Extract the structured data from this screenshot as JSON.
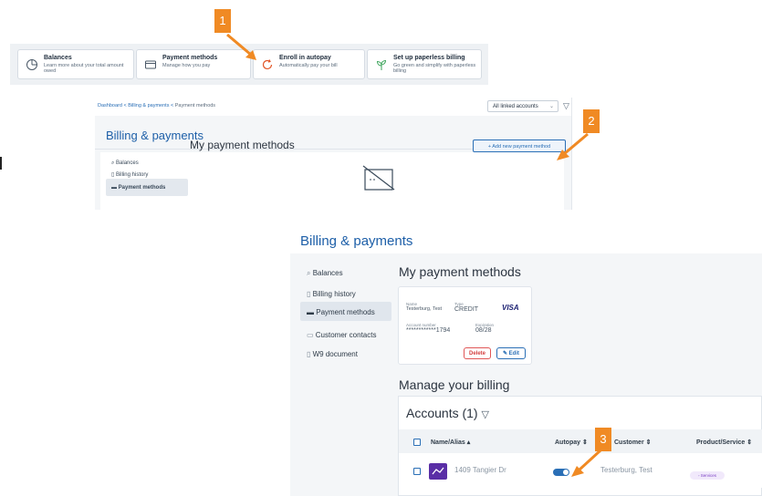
{
  "quick_links": [
    {
      "title": "Balances",
      "subtitle": "Learn more about your total amount owed",
      "icon": "pie-chart-icon"
    },
    {
      "title": "Payment methods",
      "subtitle": "Manage how you pay",
      "icon": "card-icon"
    },
    {
      "title": "Enroll in autopay",
      "subtitle": "Automatically pay your bill",
      "icon": "autopay-icon"
    },
    {
      "title": "Set up paperless billing",
      "subtitle": "Go green and simplify with paperless billing",
      "icon": "leaf-icon"
    }
  ],
  "annotations": [
    "1",
    "2",
    "3"
  ],
  "breadcrumb": {
    "dashboard": "Dashboard",
    "billing": "Billing & payments",
    "current": "Payment methods",
    "sep": "<"
  },
  "filter": {
    "accounts_select": "All linked accounts"
  },
  "page": {
    "title": "Billing & payments",
    "heading": "My payment methods",
    "add_button": "+ Add new payment method",
    "manage_heading": "Manage your billing"
  },
  "nav_short": [
    "Balances",
    "Billing history",
    "Payment methods"
  ],
  "nav": [
    "Balances",
    "Billing history",
    "Payment methods",
    "Customer contacts",
    "W9 document"
  ],
  "payment_card": {
    "name_label": "Name",
    "name": "Testerburg, Test",
    "type_label": "Type",
    "type": "CREDIT",
    "brand": "VISA",
    "account_label": "Account number",
    "account": "************1794",
    "exp_label": "Expiration",
    "expiration": "08/28",
    "delete": "Delete",
    "edit": "Edit"
  },
  "accounts": {
    "title": "Accounts (1)",
    "columns": [
      "Name/Alias",
      "Autopay",
      "Customer",
      "Product/Service"
    ],
    "rows": [
      {
        "name": "1409 Tangier Dr",
        "autopay": true,
        "customer": "Testerburg, Test",
        "product": "Services"
      }
    ]
  },
  "colors": {
    "accent": "#1d5fa8",
    "annotation": "#f08a24",
    "danger": "#d33f3f"
  }
}
